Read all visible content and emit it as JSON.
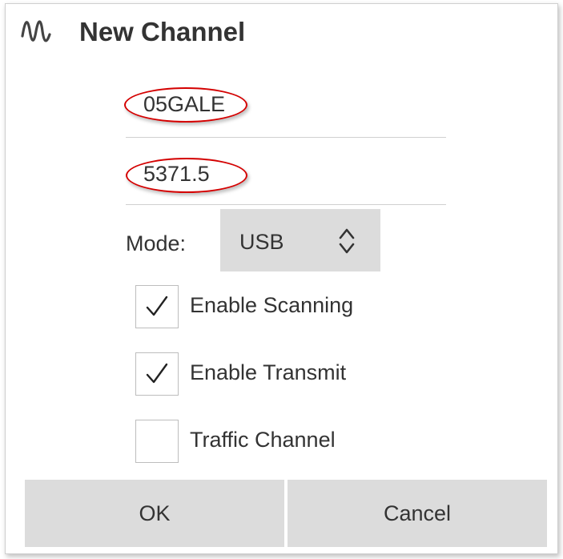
{
  "window": {
    "title": "New Channel",
    "icon": "sine-wave-icon"
  },
  "fields": {
    "channel_name": "05GALE",
    "frequency": "5371.5"
  },
  "mode": {
    "label": "Mode:",
    "value": "USB"
  },
  "options": [
    {
      "label": "Enable Scanning",
      "checked": true
    },
    {
      "label": "Enable Transmit",
      "checked": true
    },
    {
      "label": "Traffic Channel",
      "checked": false
    }
  ],
  "buttons": {
    "ok": "OK",
    "cancel": "Cancel"
  },
  "colors": {
    "highlight": "#d40000",
    "button_bg": "#dcdcdc"
  }
}
